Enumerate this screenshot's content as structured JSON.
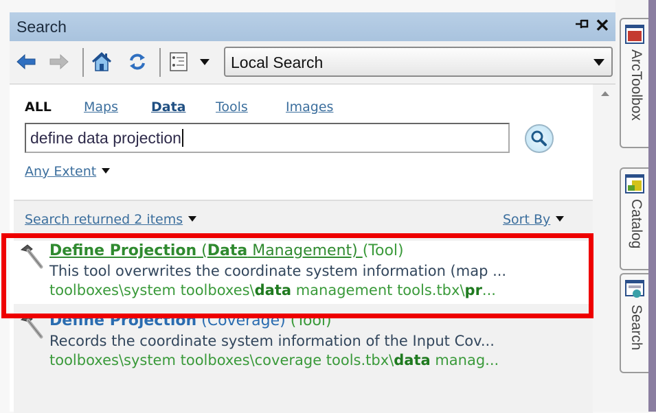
{
  "panel": {
    "title": "Search",
    "pin_icon": "pin-icon",
    "close_icon": "close-icon"
  },
  "toolbar": {
    "back_icon": "back-arrow-icon",
    "forward_icon": "forward-arrow-icon",
    "home_icon": "home-icon",
    "refresh_icon": "refresh-icon",
    "options_icon": "options-list-icon",
    "search_scope": "Local Search"
  },
  "filters": {
    "all": "ALL",
    "maps": "Maps",
    "data": "Data",
    "tools": "Tools",
    "images": "Images"
  },
  "search": {
    "query": "define data projection",
    "button_icon": "magnifier-icon"
  },
  "extent": {
    "label": "Any Extent"
  },
  "results": {
    "count_label": "Search returned 2 items",
    "sort_label": "Sort By",
    "items": [
      {
        "name": "Define Projection",
        "paren_open": " (",
        "category_bold": "Data",
        "category_rest": " Management) ",
        "type": "(Tool)",
        "description": "This tool overwrites the coordinate system information (map ...",
        "path_a": "toolboxes\\system toolboxes\\",
        "path_b": "data",
        "path_c": " management tools.tbx\\",
        "path_d": "pr",
        "path_e": "...",
        "highlighted": true
      },
      {
        "name": "Define Projection",
        "category": " (Coverage) ",
        "type": "(Tool)",
        "description": "Records the coordinate system information of the Input Cov...",
        "path_a": "toolboxes\\system toolboxes\\coverage tools.tbx\\",
        "path_b": "data",
        "path_c": " manag...",
        "highlighted": false
      }
    ]
  },
  "sidebar": {
    "tabs": [
      {
        "label": "ArcToolbox",
        "icon": "arctoolbox-icon"
      },
      {
        "label": "Catalog",
        "icon": "catalog-icon"
      },
      {
        "label": "Search",
        "icon": "search-window-icon"
      }
    ]
  },
  "colors": {
    "highlight_border": "#ee0000",
    "link": "#3b6e9d",
    "result_green": "#2f8a2f",
    "result_blue": "#2a6cb0"
  }
}
